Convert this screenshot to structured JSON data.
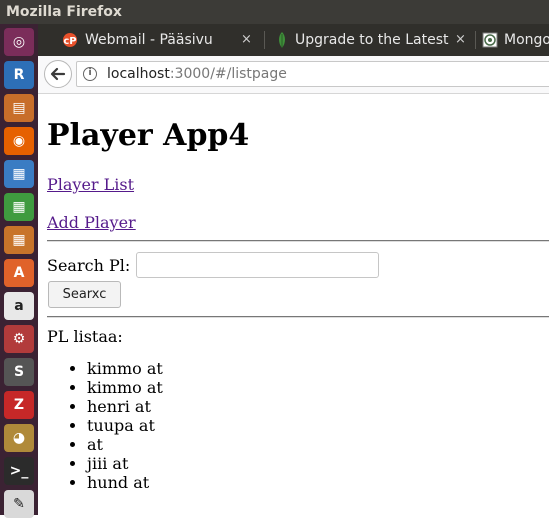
{
  "window": {
    "title": "Mozilla Firefox"
  },
  "launcher": {
    "items": [
      {
        "name": "dash-icon",
        "glyph": "◎",
        "color": "#7b2d5a"
      },
      {
        "name": "r-app-icon",
        "glyph": "R",
        "color": "#2d6fb7"
      },
      {
        "name": "files-icon",
        "glyph": "▤",
        "color": "#c86e2a"
      },
      {
        "name": "firefox-icon",
        "glyph": "◉",
        "color": "#e66000"
      },
      {
        "name": "writer-icon",
        "glyph": "▦",
        "color": "#3a7cc3"
      },
      {
        "name": "calc-icon",
        "glyph": "▦",
        "color": "#3f9b3f"
      },
      {
        "name": "impress-icon",
        "glyph": "▦",
        "color": "#c8742a"
      },
      {
        "name": "software-center-icon",
        "glyph": "A",
        "color": "#e0622a"
      },
      {
        "name": "amazon-icon",
        "glyph": "a",
        "color": "#e8e8e8"
      },
      {
        "name": "settings-icon",
        "glyph": "⚙",
        "color": "#b23b3b"
      },
      {
        "name": "sublime-icon",
        "glyph": "S",
        "color": "#555555"
      },
      {
        "name": "filezilla-icon",
        "glyph": "Z",
        "color": "#c62828"
      },
      {
        "name": "gimp-icon",
        "glyph": "◕",
        "color": "#b08a3a"
      },
      {
        "name": "terminal-icon",
        "glyph": ">_",
        "color": "#2b2b2b"
      },
      {
        "name": "text-editor-icon",
        "glyph": "✎",
        "color": "#d9d9d9"
      }
    ]
  },
  "tabs": [
    {
      "label": "Webmail - Pääsivu",
      "close": "×",
      "favicon_color": "#e8512b"
    },
    {
      "label": "Upgrade to the Latest",
      "close": "×",
      "favicon_color": "#3f8f3a"
    },
    {
      "label": "Mongo",
      "close": "",
      "favicon_color": "#7a7a7a"
    }
  ],
  "navbar": {
    "url_host": "localhost",
    "url_rest": ":3000/#/listpage"
  },
  "page": {
    "title": "Player App4",
    "link_list": "Player List",
    "link_add": "Add Player",
    "search_label": "Search Pl:",
    "search_value": "",
    "search_button": "Searxc",
    "list_heading": "PL listaa:",
    "players": [
      "kimmo at",
      "kimmo at",
      "henri at",
      "tuupa at",
      "at",
      "jiii at",
      "hund at"
    ]
  }
}
